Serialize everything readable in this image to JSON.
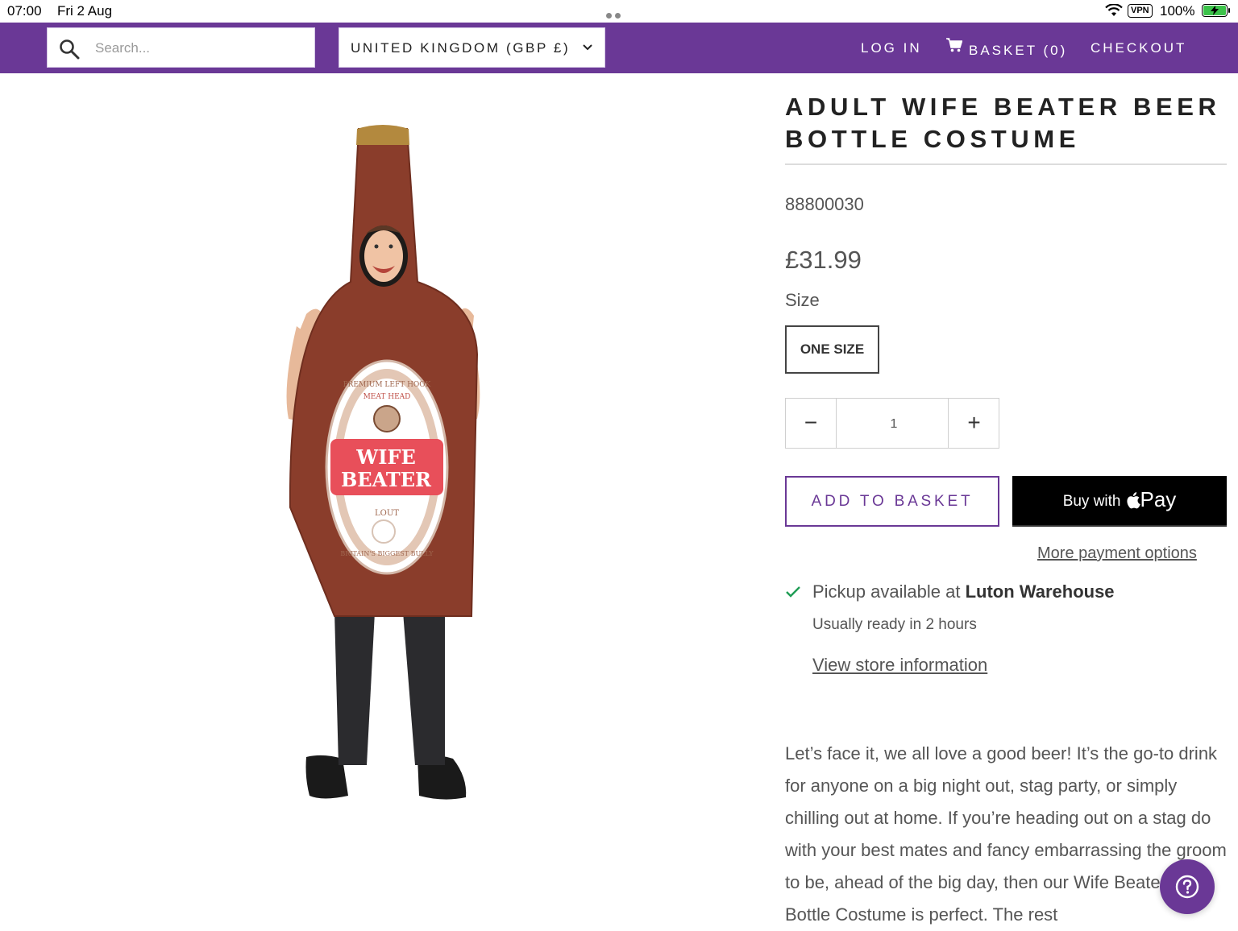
{
  "status_bar": {
    "time": "07:00",
    "date": "Fri 2 Aug",
    "vpn": "VPN",
    "battery": "100%"
  },
  "header": {
    "search_placeholder": "Search...",
    "currency": "UNITED KINGDOM (GBP £)",
    "login": "LOG IN",
    "basket": "BASKET (0)",
    "checkout": "CHECKOUT",
    "background_color": "#6a3896"
  },
  "product": {
    "image_label": {
      "line1": "WIFE",
      "line2": "BEATER",
      "top_arc": "PREMIUM LEFT HOOK",
      "sub": "MEAT HEAD",
      "bottom": "LOUT",
      "bottom_arc": "BRITAIN'S BIGGEST BULLY"
    },
    "title": "ADULT WIFE BEATER BEER BOTTLE COSTUME",
    "sku": "88800030",
    "price": "£31.99",
    "size_label": "Size",
    "size_option": "ONE SIZE",
    "quantity": "1",
    "minus": "−",
    "plus": "+",
    "add_to_basket": "ADD TO BASKET",
    "apple_pay_prefix": "Buy with",
    "apple_pay_suffix": "Pay",
    "more_payment": "More payment options",
    "pickup_prefix": "Pickup available at",
    "pickup_location": "Luton Warehouse",
    "pickup_ready": "Usually ready in 2 hours",
    "view_store": "View store information",
    "description": "Let’s face it, we all love a good beer! It’s the go-to drink for anyone on a big night out, stag party, or simply chilling out at home. If you’re heading out on a stag do with your best mates and fancy embarrassing the groom to be, ahead of the big day, then our Wife Beater Beer Bottle Costume is perfect. The rest",
    "accent_color": "#6a3896"
  }
}
